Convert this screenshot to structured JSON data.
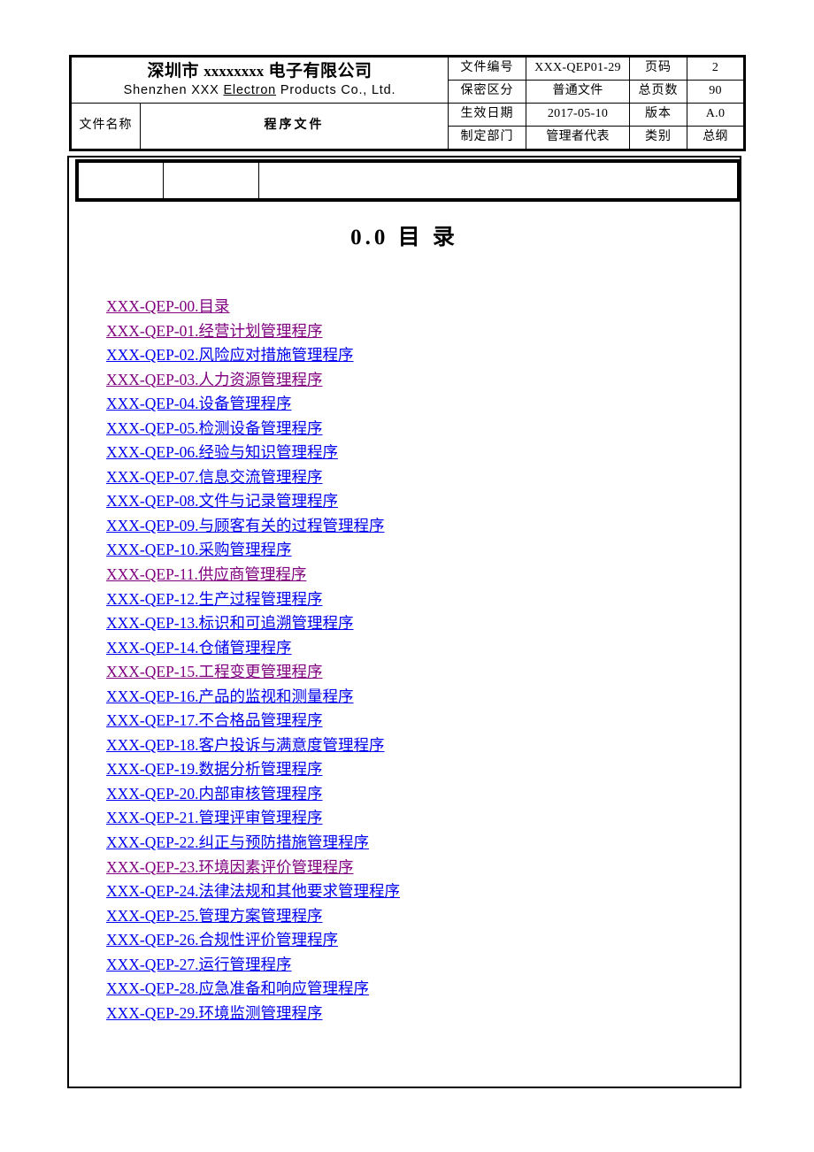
{
  "header": {
    "company_cn": "深圳市 xxxxxxxx 电子有限公司",
    "company_cn_prefix": "深圳市",
    "company_cn_x": "xxxxxxxx",
    "company_cn_suffix": "电子有限公司",
    "company_en_part1": "Shenzhen XXX ",
    "company_en_underlined": "Electron",
    "company_en_part2": " Products Co., Ltd.",
    "doc_name_label": "文件名称",
    "doc_name_value": "程序文件",
    "meta": [
      {
        "label": "文件编号",
        "value": "XXX-QEP01-29",
        "label2": "页码",
        "value2": "2"
      },
      {
        "label": "保密区分",
        "value": "普通文件",
        "label2": "总页数",
        "value2": "90"
      },
      {
        "label": "生效日期",
        "value": "2017-05-10",
        "label2": "版本",
        "value2": "A.0"
      },
      {
        "label": "制定部门",
        "value": "管理者代表",
        "label2": "类别",
        "value2": "总纲"
      }
    ]
  },
  "sub_table": {
    "cells": [
      "",
      "",
      ""
    ]
  },
  "section": {
    "title": "0.0  目  录"
  },
  "colors": {
    "visited_link": "#800080",
    "unvisited_link": "#0000ee",
    "text": "#000000",
    "background": "#ffffff"
  },
  "toc": {
    "items": [
      {
        "label": "XXX-QEP-00.目录",
        "state": "visited"
      },
      {
        "label": "XXX-QEP-01.经营计划管理程序",
        "state": "visited"
      },
      {
        "label": "XXX-QEP-02.风险应对措施管理程序",
        "state": "unvisited"
      },
      {
        "label": "XXX-QEP-03.人力资源管理程序",
        "state": "visited"
      },
      {
        "label": "XXX-QEP-04.设备管理程序",
        "state": "unvisited"
      },
      {
        "label": "XXX-QEP-05.检测设备管理程序",
        "state": "unvisited"
      },
      {
        "label": "XXX-QEP-06.经验与知识管理程序",
        "state": "unvisited"
      },
      {
        "label": "XXX-QEP-07.信息交流管理程序",
        "state": "unvisited"
      },
      {
        "label": "XXX-QEP-08.文件与记录管理程序",
        "state": "unvisited"
      },
      {
        "label": "XXX-QEP-09.与顾客有关的过程管理程序",
        "state": "unvisited"
      },
      {
        "label": "XXX-QEP-10.采购管理程序",
        "state": "unvisited"
      },
      {
        "label": "XXX-QEP-11.供应商管理程序",
        "state": "visited"
      },
      {
        "label": "XXX-QEP-12.生产过程管理程序",
        "state": "unvisited"
      },
      {
        "label": "XXX-QEP-13.标识和可追溯管理程序",
        "state": "unvisited"
      },
      {
        "label": "XXX-QEP-14.仓储管理程序",
        "state": "unvisited"
      },
      {
        "label": "XXX-QEP-15.工程变更管理程序",
        "state": "visited"
      },
      {
        "label": "XXX-QEP-16.产品的监视和测量程序",
        "state": "unvisited"
      },
      {
        "label": "XXX-QEP-17.不合格品管理程序",
        "state": "unvisited"
      },
      {
        "label": "XXX-QEP-18.客户投诉与满意度管理程序",
        "state": "unvisited"
      },
      {
        "label": "XXX-QEP-19.数据分析管理程序",
        "state": "unvisited"
      },
      {
        "label": "XXX-QEP-20.内部审核管理程序",
        "state": "unvisited"
      },
      {
        "label": "XXX-QEP-21.管理评审管理程序",
        "state": "unvisited"
      },
      {
        "label": "XXX-QEP-22.纠正与预防措施管理程序",
        "state": "unvisited"
      },
      {
        "label": "XXX-QEP-23.环境因素评价管理程序",
        "state": "visited"
      },
      {
        "label": "XXX-QEP-24.法律法规和其他要求管理程序",
        "state": "unvisited"
      },
      {
        "label": "XXX-QEP-25.管理方案管理程序",
        "state": "unvisited"
      },
      {
        "label": "XXX-QEP-26.合规性评价管理程序",
        "state": "unvisited"
      },
      {
        "label": "XXX-QEP-27.运行管理程序",
        "state": "unvisited"
      },
      {
        "label": "XXX-QEP-28.应急准备和响应管理程序",
        "state": "unvisited"
      },
      {
        "label": "XXX-QEP-29.环境监测管理程序",
        "state": "unvisited"
      }
    ]
  }
}
